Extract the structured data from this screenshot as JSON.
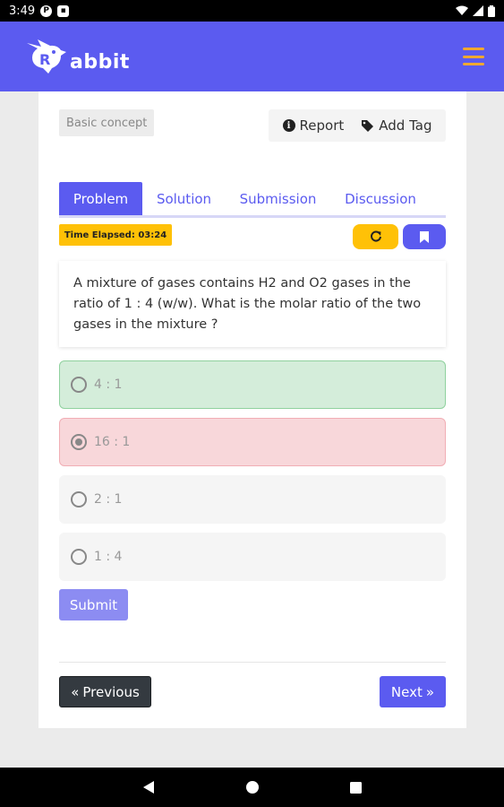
{
  "status_bar": {
    "time": "3:49"
  },
  "app": {
    "logo_text": "abbit"
  },
  "header": {
    "tag": "Basic concept",
    "report_label": "Report",
    "add_tag_label": "Add Tag"
  },
  "tabs": [
    {
      "label": "Problem",
      "active": true
    },
    {
      "label": "Solution",
      "active": false
    },
    {
      "label": "Submission",
      "active": false
    },
    {
      "label": "Discussion",
      "active": false
    }
  ],
  "timer": {
    "label": "Time Elapsed: 03:24"
  },
  "question": {
    "text": "A mixture of gases contains H2 and O2 gases in the ratio of 1 : 4 (w/w). What is the molar ratio of the two gases in the mixture ?"
  },
  "options": [
    {
      "label": "4 : 1",
      "state": "correct",
      "selected": false
    },
    {
      "label": "16 : 1",
      "state": "wrong",
      "selected": true
    },
    {
      "label": "2 : 1",
      "state": "neutral",
      "selected": false
    },
    {
      "label": "1 : 4",
      "state": "neutral",
      "selected": false
    }
  ],
  "buttons": {
    "submit": "Submit",
    "previous": "Previous",
    "next": "Next"
  },
  "colors": {
    "primary": "#5b5bf0",
    "accent": "#ffc107",
    "menu": "#f0a830",
    "correct_bg": "#d4edda",
    "wrong_bg": "#f8d7da",
    "dark_button": "#343a40"
  }
}
